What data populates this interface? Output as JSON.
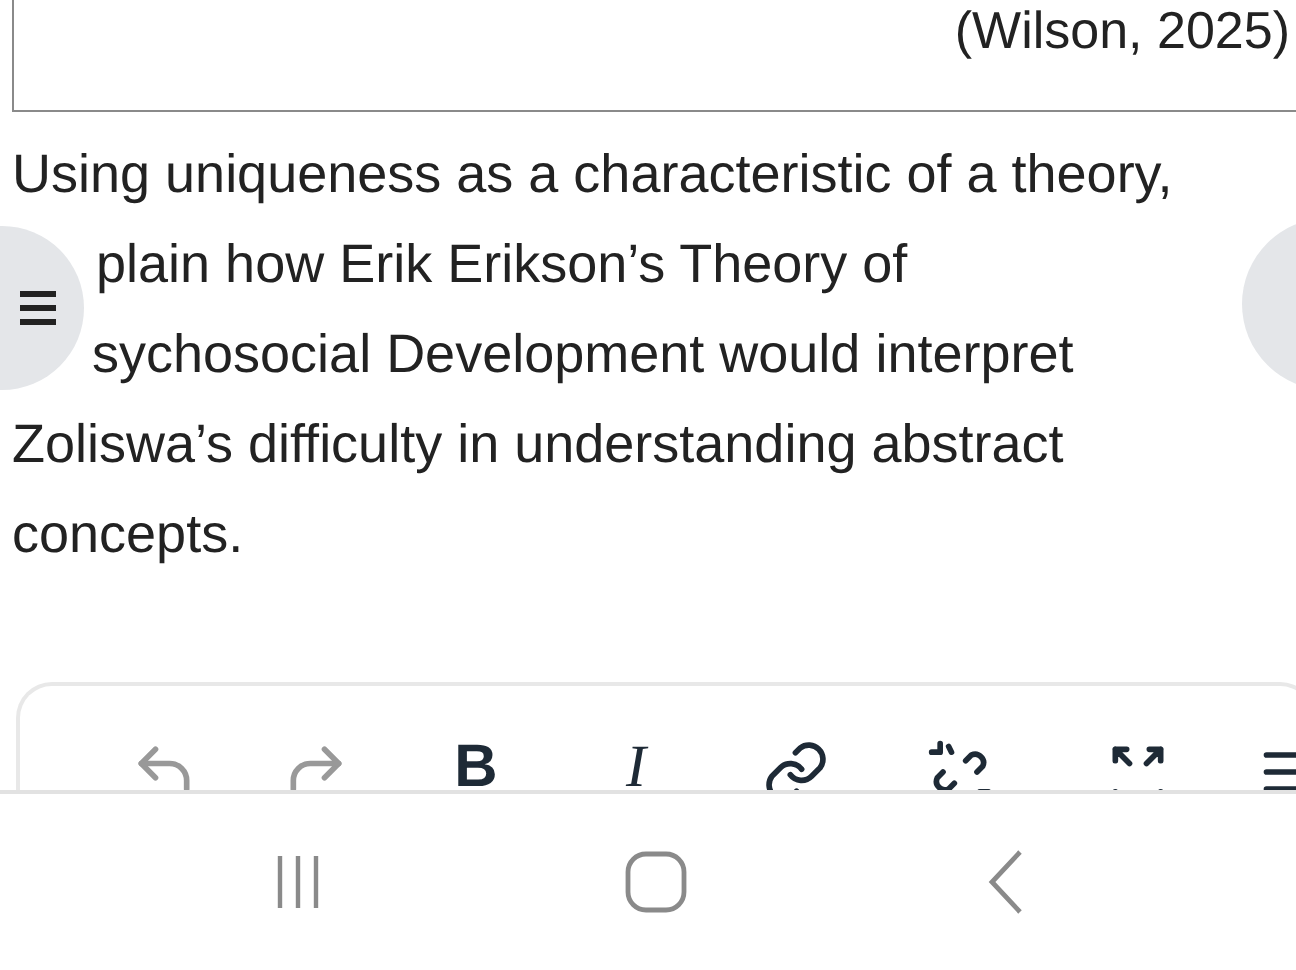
{
  "citation": "(Wilson, 2025)",
  "question_lines": [
    "Using uniqueness as a characteristic of a theory,",
    "plain how Erik Erikson’s Theory of",
    "sychosocial Development would interpret",
    "Zoliswa’s difficulty in understanding abstract",
    "concepts."
  ],
  "toolbar": [
    {
      "kind": "undo",
      "disabled": true
    },
    {
      "kind": "redo",
      "disabled": true
    },
    {
      "kind": "bold",
      "label": "B",
      "disabled": false
    },
    {
      "kind": "italic",
      "label": "I",
      "disabled": false
    },
    {
      "kind": "link",
      "disabled": false
    },
    {
      "kind": "unlink",
      "disabled": false
    },
    {
      "kind": "fullscreen",
      "disabled": false
    },
    {
      "kind": "align",
      "disabled": false
    }
  ],
  "nav": [
    {
      "kind": "recent"
    },
    {
      "kind": "home"
    },
    {
      "kind": "back"
    }
  ]
}
